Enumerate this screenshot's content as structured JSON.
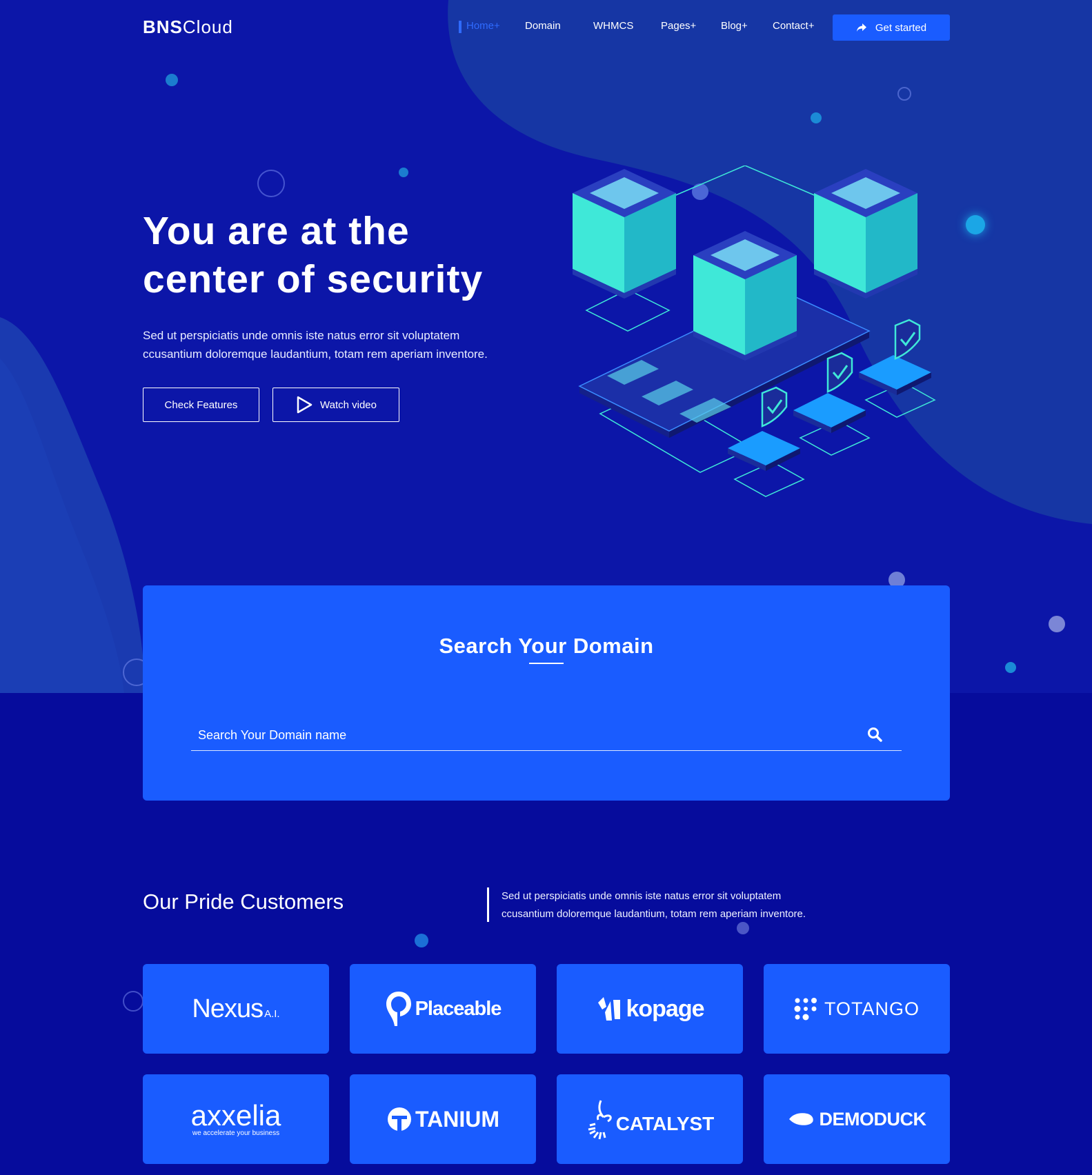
{
  "brand": {
    "bold": "BNS",
    "light": "Cloud"
  },
  "nav": {
    "items": [
      "Home+",
      "Domain",
      "WHMCS",
      "Pages+",
      "Blog+",
      "Contact+"
    ],
    "cta_label": "Get started"
  },
  "hero": {
    "title_line1": "You are at the",
    "title_line2": "center of security",
    "desc_line1": "Sed ut perspiciatis unde omnis iste natus error sit voluptatem",
    "desc_line2": "ccusantium doloremque laudantium, totam rem aperiam inventore.",
    "primary_button": "Check Features",
    "video_button": "Watch video"
  },
  "search": {
    "title": "Search Your Domain",
    "placeholder": "Search Your Domain name"
  },
  "customers": {
    "title": "Our Pride Customers",
    "desc_line1": "Sed ut perspiciatis unde omnis iste natus error sit voluptatem",
    "desc_line2": "ccusantium doloremque laudantium, totam rem aperiam inventore.",
    "logos": [
      {
        "name": "Nexus",
        "suffix": "A.I."
      },
      {
        "name": "Placeable"
      },
      {
        "name": "kopage"
      },
      {
        "name": "TOTANGO"
      },
      {
        "name": "axxelia",
        "suffix": "we accelerate your business"
      },
      {
        "name": "TANIUM"
      },
      {
        "name": "CATALYST"
      },
      {
        "name": "DEMODUCK"
      }
    ]
  },
  "colors": {
    "bg_dark": "#060c9c",
    "hero_bg": "#0c16a8",
    "accent": "#1a5cff",
    "teal": "#3fe8d8"
  }
}
